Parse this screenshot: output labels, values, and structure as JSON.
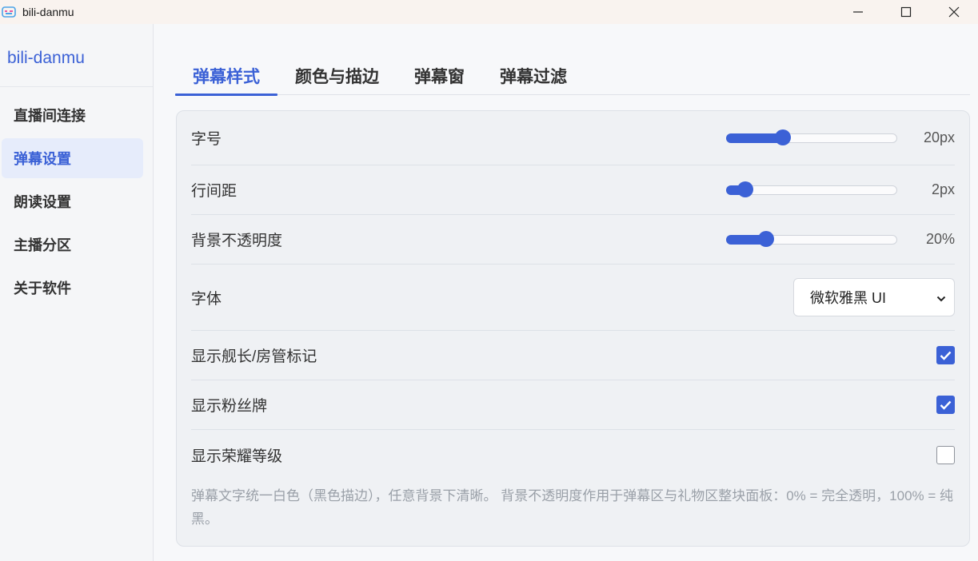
{
  "window": {
    "title": "bili-danmu",
    "minimize_icon": "minimize-icon",
    "maximize_icon": "maximize-icon",
    "close_icon": "close-icon"
  },
  "sidebar": {
    "brand": "bili-danmu",
    "items": [
      {
        "label": "直播间连接"
      },
      {
        "label": "弹幕设置"
      },
      {
        "label": "朗读设置"
      },
      {
        "label": "主播分区"
      },
      {
        "label": "关于软件"
      }
    ],
    "active_index": 1
  },
  "tabs": [
    {
      "label": "弹幕样式"
    },
    {
      "label": "颜色与描边"
    },
    {
      "label": "弹幕窗"
    },
    {
      "label": "弹幕过滤"
    }
  ],
  "active_tab": 0,
  "settings": {
    "font_size": {
      "label": "字号",
      "value_text": "20px",
      "level": 0.33
    },
    "line_spacing": {
      "label": "行间距",
      "value_text": "2px",
      "level": 0.11
    },
    "bg_opacity": {
      "label": "背景不透明度",
      "value_text": "20%",
      "level": 0.23
    },
    "font": {
      "label": "字体",
      "selected": "微软雅黑 UI"
    },
    "show_captain": {
      "label": "显示舰长/房管标记",
      "checked": true
    },
    "show_fan_badge": {
      "label": "显示粉丝牌",
      "checked": true
    },
    "show_honor_level": {
      "label": "显示荣耀等级",
      "checked": false
    },
    "note": "弹幕文字统一白色（黑色描边），任意背景下清晰。 背景不透明度作用于弹幕区与礼物区整块面板：0% = 完全透明，100% = 纯黑。"
  },
  "colors": {
    "accent": "#3b61d6"
  }
}
